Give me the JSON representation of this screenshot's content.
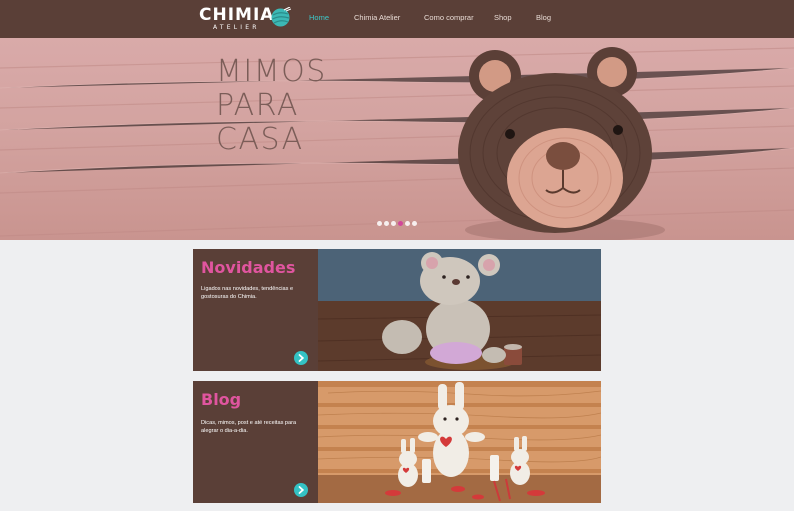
{
  "header": {
    "logo": {
      "name": "CHIMIA",
      "subtitle": "ATELIER",
      "icon": "yarn-ball-icon"
    },
    "nav": [
      {
        "label": "Home",
        "active": true
      },
      {
        "label": "Chimia Atelier",
        "active": false
      },
      {
        "label": "Como comprar",
        "active": false
      },
      {
        "label": "Shop",
        "active": false
      },
      {
        "label": "Blog",
        "active": false
      }
    ]
  },
  "hero": {
    "title_lines": [
      "MIMOS",
      "PARA",
      "CASA"
    ],
    "slider": {
      "slide_count": 6,
      "active_index": 3
    }
  },
  "cards": [
    {
      "title": "Novidades",
      "text": "Ligados nas novidades, tendências e gostosuras do Chimia.",
      "arrow_icon": "arrow-right-circle-icon"
    },
    {
      "title": "Blog",
      "text": "Dicas, mimos, post e até receitas para alegrar o dia-a-dia.",
      "arrow_icon": "arrow-right-circle-icon"
    }
  ],
  "colors": {
    "header_bg": "#5a3f37",
    "nav_active": "#3cc8c8",
    "accent_pink": "#e0559f",
    "arrow_teal": "#33c2c4",
    "page_bg": "#eeeff1"
  }
}
